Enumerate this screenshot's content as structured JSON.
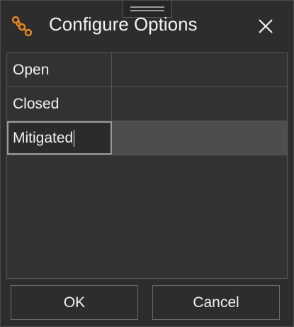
{
  "dialog": {
    "title": "Configure Options",
    "icon": "workflow-nodes-icon",
    "close_icon": "close-icon"
  },
  "options": [
    {
      "name": "Open",
      "value": ""
    },
    {
      "name": "Closed",
      "value": ""
    },
    {
      "name": "Mitigated",
      "value": "",
      "editing": true
    }
  ],
  "buttons": {
    "ok_label": "OK",
    "cancel_label": "Cancel"
  },
  "colors": {
    "accent": "#e8891e",
    "background": "#2d2d2d",
    "text": "#f2f2f2"
  }
}
